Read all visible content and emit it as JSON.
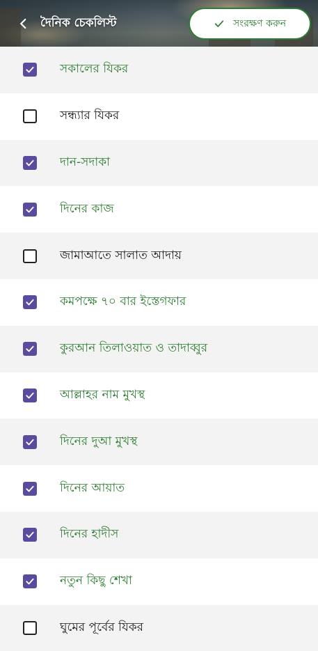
{
  "header": {
    "title": "দৈনিক চেকলিস্ট",
    "save_label": "সংরক্ষণ করুন",
    "back_icon": "chevron-left-icon",
    "save_icon": "check-icon"
  },
  "colors": {
    "checked_box": "#5b4b9e",
    "checked_text": "#2e7d32",
    "unchecked_text": "#1a1a1a",
    "accent": "#2e7d32"
  },
  "items": [
    {
      "label": "সকালের যিকর",
      "checked": true
    },
    {
      "label": "সন্ধ্যার যিকর",
      "checked": false
    },
    {
      "label": "দান-সদাকা",
      "checked": true
    },
    {
      "label": "দিনের কাজ",
      "checked": true
    },
    {
      "label": "জামাআতে সালাত আদায়",
      "checked": false
    },
    {
      "label": "কমপক্ষে ৭০ বার ইস্তেগফার",
      "checked": true
    },
    {
      "label": "কুরআন তিলাওয়াত ও তাদাব্বুর",
      "checked": true
    },
    {
      "label": "আল্লাহর নাম মুখস্থ",
      "checked": true
    },
    {
      "label": "দিনের দুআ মুখস্থ",
      "checked": true
    },
    {
      "label": "দিনের আয়াত",
      "checked": true
    },
    {
      "label": "দিনের হাদীস",
      "checked": true
    },
    {
      "label": "নতুন কিছু শেখা",
      "checked": true
    },
    {
      "label": "ঘুমের পূর্বের যিকর",
      "checked": false
    }
  ]
}
